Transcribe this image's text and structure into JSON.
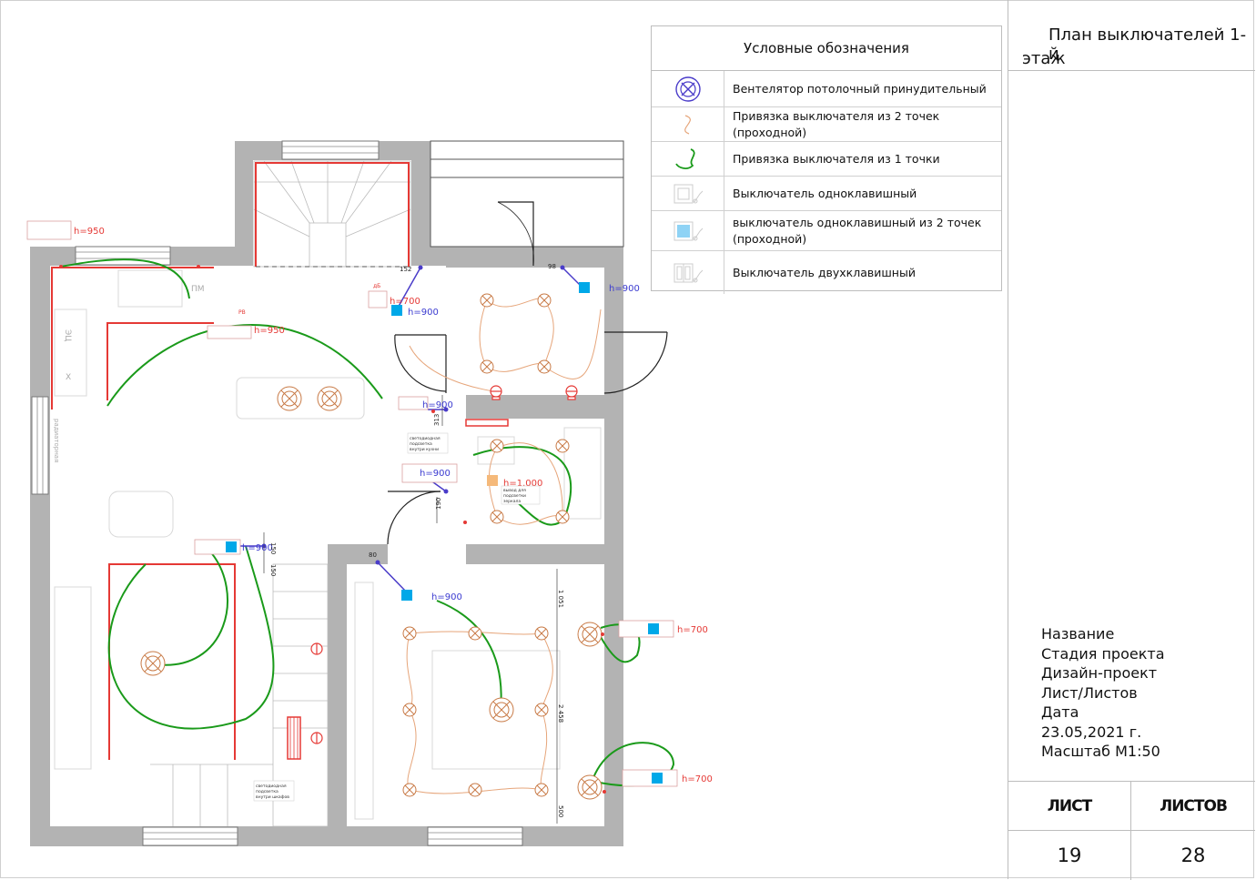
{
  "title_block": {
    "title_line1": "План выключателей 1-й",
    "title_line2": "этаж",
    "info_lines": [
      "Название",
      "Стадия проекта",
      "Дизайн-проект",
      "Лист/Листов",
      "Дата",
      "23.05,2021 г.",
      "Масштаб М1:50"
    ],
    "sheet_label": "ЛИСТ",
    "sheets_label": "ЛИСТОВ",
    "sheet_number": "19",
    "sheets_total": "28"
  },
  "legend": {
    "title": "Условные обозначения",
    "items": [
      {
        "symbol": "ceiling-fan-icon",
        "text": "Вентелятор потолочный принудительный"
      },
      {
        "symbol": "two-point-link-icon",
        "text": "Привязка выключателя из 2 точек (проходной)"
      },
      {
        "symbol": "one-point-link-icon",
        "text": "Привязка выключателя из 1 точки"
      },
      {
        "symbol": "single-switch-icon",
        "text": "Выключатель одноклавишный"
      },
      {
        "symbol": "passthrough-switch-icon",
        "text": "выключатель одноклавишный из 2 точек (проходной)"
      },
      {
        "symbol": "double-switch-icon",
        "text": "Выключатель двухклавишный"
      }
    ]
  },
  "plan": {
    "heights": [
      "h=950",
      "h=950",
      "h=700",
      "h=900",
      "h=900",
      "h=900",
      "h=900",
      "h=1.000",
      "h=900",
      "h=900",
      "h=700",
      "h=700"
    ],
    "dims": [
      "152",
      "98",
      "313",
      "190",
      "150",
      "150",
      "80",
      "1 051",
      "2 458",
      "500"
    ],
    "room_marks": [
      "ПМ",
      "ЭЦ",
      "X",
      "дБ",
      "РВ",
      "радиаторная"
    ],
    "notes": {
      "kitchen": [
        "светодиодная",
        "подсветка",
        "внутри кухни"
      ],
      "mirror": [
        "вывод для",
        "подсветки",
        "зеркала"
      ],
      "closet": [
        "светодиодная",
        "подсветка",
        "внутри шкафов"
      ]
    }
  },
  "colors": {
    "wall": "#b3b3b3",
    "one_point_link": "#1a9a1a",
    "two_point_link": "#e6a57a",
    "switch": "#00a8e8",
    "lamp": "#c87a46",
    "red_marks": "#e53935",
    "purple_link": "#4a3cc9"
  }
}
